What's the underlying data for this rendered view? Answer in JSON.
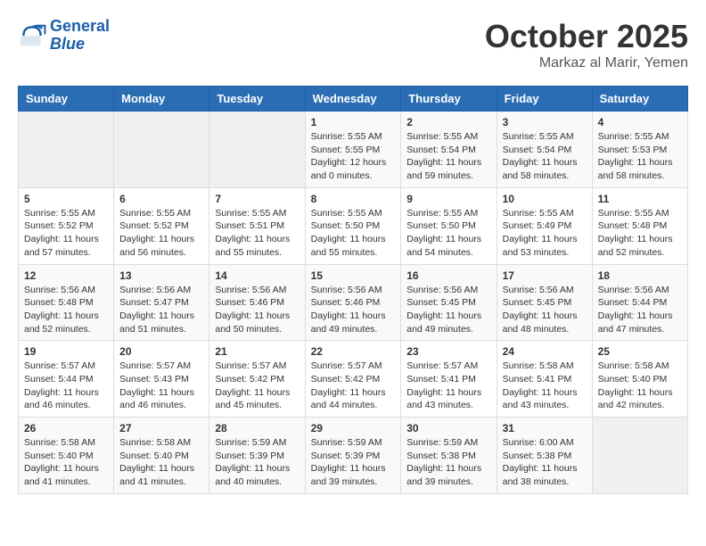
{
  "logo": {
    "line1": "General",
    "line2": "Blue"
  },
  "title": "October 2025",
  "location": "Markaz al Marir, Yemen",
  "days_of_week": [
    "Sunday",
    "Monday",
    "Tuesday",
    "Wednesday",
    "Thursday",
    "Friday",
    "Saturday"
  ],
  "weeks": [
    [
      {
        "day": "",
        "sunrise": "",
        "sunset": "",
        "daylight": ""
      },
      {
        "day": "",
        "sunrise": "",
        "sunset": "",
        "daylight": ""
      },
      {
        "day": "",
        "sunrise": "",
        "sunset": "",
        "daylight": ""
      },
      {
        "day": "1",
        "sunrise": "Sunrise: 5:55 AM",
        "sunset": "Sunset: 5:55 PM",
        "daylight": "Daylight: 12 hours and 0 minutes."
      },
      {
        "day": "2",
        "sunrise": "Sunrise: 5:55 AM",
        "sunset": "Sunset: 5:54 PM",
        "daylight": "Daylight: 11 hours and 59 minutes."
      },
      {
        "day": "3",
        "sunrise": "Sunrise: 5:55 AM",
        "sunset": "Sunset: 5:54 PM",
        "daylight": "Daylight: 11 hours and 58 minutes."
      },
      {
        "day": "4",
        "sunrise": "Sunrise: 5:55 AM",
        "sunset": "Sunset: 5:53 PM",
        "daylight": "Daylight: 11 hours and 58 minutes."
      }
    ],
    [
      {
        "day": "5",
        "sunrise": "Sunrise: 5:55 AM",
        "sunset": "Sunset: 5:52 PM",
        "daylight": "Daylight: 11 hours and 57 minutes."
      },
      {
        "day": "6",
        "sunrise": "Sunrise: 5:55 AM",
        "sunset": "Sunset: 5:52 PM",
        "daylight": "Daylight: 11 hours and 56 minutes."
      },
      {
        "day": "7",
        "sunrise": "Sunrise: 5:55 AM",
        "sunset": "Sunset: 5:51 PM",
        "daylight": "Daylight: 11 hours and 55 minutes."
      },
      {
        "day": "8",
        "sunrise": "Sunrise: 5:55 AM",
        "sunset": "Sunset: 5:50 PM",
        "daylight": "Daylight: 11 hours and 55 minutes."
      },
      {
        "day": "9",
        "sunrise": "Sunrise: 5:55 AM",
        "sunset": "Sunset: 5:50 PM",
        "daylight": "Daylight: 11 hours and 54 minutes."
      },
      {
        "day": "10",
        "sunrise": "Sunrise: 5:55 AM",
        "sunset": "Sunset: 5:49 PM",
        "daylight": "Daylight: 11 hours and 53 minutes."
      },
      {
        "day": "11",
        "sunrise": "Sunrise: 5:55 AM",
        "sunset": "Sunset: 5:48 PM",
        "daylight": "Daylight: 11 hours and 52 minutes."
      }
    ],
    [
      {
        "day": "12",
        "sunrise": "Sunrise: 5:56 AM",
        "sunset": "Sunset: 5:48 PM",
        "daylight": "Daylight: 11 hours and 52 minutes."
      },
      {
        "day": "13",
        "sunrise": "Sunrise: 5:56 AM",
        "sunset": "Sunset: 5:47 PM",
        "daylight": "Daylight: 11 hours and 51 minutes."
      },
      {
        "day": "14",
        "sunrise": "Sunrise: 5:56 AM",
        "sunset": "Sunset: 5:46 PM",
        "daylight": "Daylight: 11 hours and 50 minutes."
      },
      {
        "day": "15",
        "sunrise": "Sunrise: 5:56 AM",
        "sunset": "Sunset: 5:46 PM",
        "daylight": "Daylight: 11 hours and 49 minutes."
      },
      {
        "day": "16",
        "sunrise": "Sunrise: 5:56 AM",
        "sunset": "Sunset: 5:45 PM",
        "daylight": "Daylight: 11 hours and 49 minutes."
      },
      {
        "day": "17",
        "sunrise": "Sunrise: 5:56 AM",
        "sunset": "Sunset: 5:45 PM",
        "daylight": "Daylight: 11 hours and 48 minutes."
      },
      {
        "day": "18",
        "sunrise": "Sunrise: 5:56 AM",
        "sunset": "Sunset: 5:44 PM",
        "daylight": "Daylight: 11 hours and 47 minutes."
      }
    ],
    [
      {
        "day": "19",
        "sunrise": "Sunrise: 5:57 AM",
        "sunset": "Sunset: 5:44 PM",
        "daylight": "Daylight: 11 hours and 46 minutes."
      },
      {
        "day": "20",
        "sunrise": "Sunrise: 5:57 AM",
        "sunset": "Sunset: 5:43 PM",
        "daylight": "Daylight: 11 hours and 46 minutes."
      },
      {
        "day": "21",
        "sunrise": "Sunrise: 5:57 AM",
        "sunset": "Sunset: 5:42 PM",
        "daylight": "Daylight: 11 hours and 45 minutes."
      },
      {
        "day": "22",
        "sunrise": "Sunrise: 5:57 AM",
        "sunset": "Sunset: 5:42 PM",
        "daylight": "Daylight: 11 hours and 44 minutes."
      },
      {
        "day": "23",
        "sunrise": "Sunrise: 5:57 AM",
        "sunset": "Sunset: 5:41 PM",
        "daylight": "Daylight: 11 hours and 43 minutes."
      },
      {
        "day": "24",
        "sunrise": "Sunrise: 5:58 AM",
        "sunset": "Sunset: 5:41 PM",
        "daylight": "Daylight: 11 hours and 43 minutes."
      },
      {
        "day": "25",
        "sunrise": "Sunrise: 5:58 AM",
        "sunset": "Sunset: 5:40 PM",
        "daylight": "Daylight: 11 hours and 42 minutes."
      }
    ],
    [
      {
        "day": "26",
        "sunrise": "Sunrise: 5:58 AM",
        "sunset": "Sunset: 5:40 PM",
        "daylight": "Daylight: 11 hours and 41 minutes."
      },
      {
        "day": "27",
        "sunrise": "Sunrise: 5:58 AM",
        "sunset": "Sunset: 5:40 PM",
        "daylight": "Daylight: 11 hours and 41 minutes."
      },
      {
        "day": "28",
        "sunrise": "Sunrise: 5:59 AM",
        "sunset": "Sunset: 5:39 PM",
        "daylight": "Daylight: 11 hours and 40 minutes."
      },
      {
        "day": "29",
        "sunrise": "Sunrise: 5:59 AM",
        "sunset": "Sunset: 5:39 PM",
        "daylight": "Daylight: 11 hours and 39 minutes."
      },
      {
        "day": "30",
        "sunrise": "Sunrise: 5:59 AM",
        "sunset": "Sunset: 5:38 PM",
        "daylight": "Daylight: 11 hours and 39 minutes."
      },
      {
        "day": "31",
        "sunrise": "Sunrise: 6:00 AM",
        "sunset": "Sunset: 5:38 PM",
        "daylight": "Daylight: 11 hours and 38 minutes."
      },
      {
        "day": "",
        "sunrise": "",
        "sunset": "",
        "daylight": ""
      }
    ]
  ]
}
